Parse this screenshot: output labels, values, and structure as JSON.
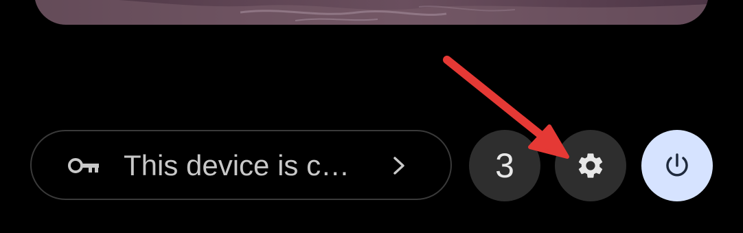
{
  "wallpaper": {
    "name": "wallpaper-preview"
  },
  "managed_notice": {
    "label": "This device is c…",
    "icon": "key-icon",
    "chevron": "chevron-right-icon"
  },
  "notifications": {
    "count": "3"
  },
  "settings": {
    "icon": "gear-icon"
  },
  "power": {
    "icon": "power-icon"
  },
  "colors": {
    "background": "#000000",
    "pill_border": "#3a3a3a",
    "button_bg": "#2e2e2e",
    "power_bg": "#d6e3ff",
    "annotation_arrow": "#e53935"
  }
}
